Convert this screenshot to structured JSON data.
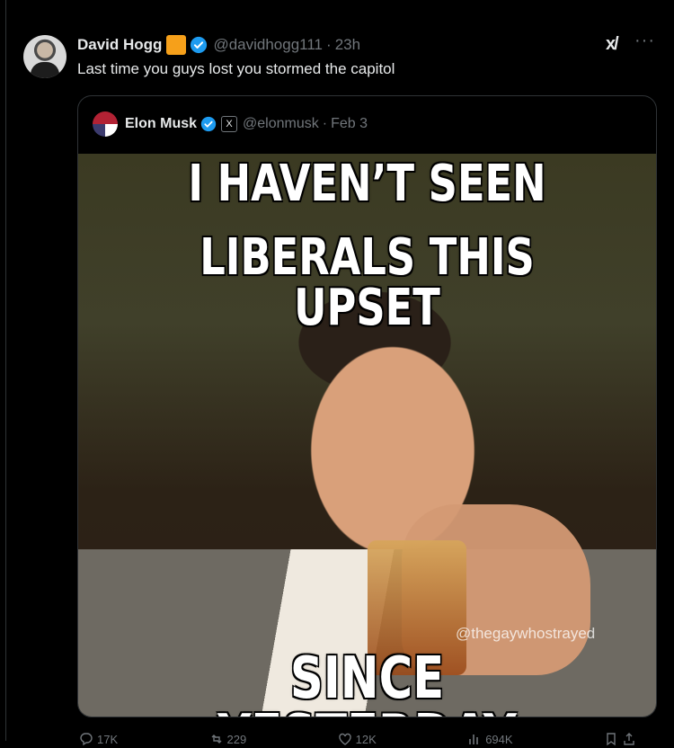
{
  "tweet": {
    "author_name": "David Hogg",
    "author_handle": "@davidhogg111",
    "separator": "·",
    "time": "23h",
    "text": "Last time you guys lost you stormed the capitol",
    "colors": {
      "org_badge": "#f6a01a",
      "verified": "#1d9bf0"
    }
  },
  "quoted_tweet": {
    "author_name": "Elon Musk",
    "author_handle": "@elonmusk",
    "separator": "·",
    "time": "Feb 3",
    "affiliate_badge": "X"
  },
  "meme": {
    "line1": "I HAVEN’T SEEN",
    "line2": "LIBERALS THIS UPSET",
    "line3": "SINCE YESTERDAY",
    "watermark": "@thegaywhostrayed"
  },
  "actions": {
    "replies": "17K",
    "reposts": "229",
    "likes": "12K",
    "views": "694K"
  },
  "icons": [
    "grok-icon",
    "more-icon",
    "verified-icon",
    "reply-icon",
    "repost-icon",
    "like-icon",
    "views-icon",
    "bookmark-icon",
    "share-icon"
  ]
}
